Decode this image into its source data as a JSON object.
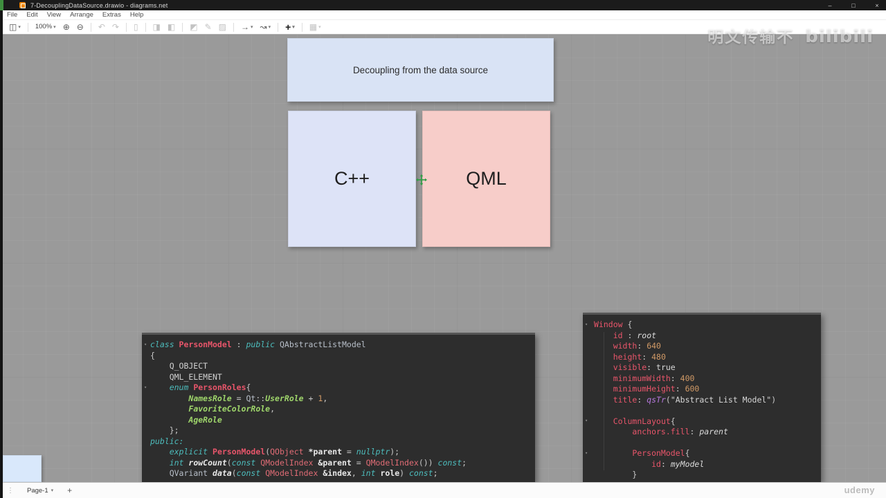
{
  "window": {
    "title": "7-DecouplingDataSource.drawio - diagrams.net",
    "minimize": "–",
    "maximize": "□",
    "close": "×"
  },
  "menu": {
    "items": [
      "File",
      "Edit",
      "View",
      "Arrange",
      "Extras",
      "Help"
    ]
  },
  "toolbar": {
    "view_glyph": "◫",
    "caret": "▾",
    "zoom_level": "100%",
    "zoom_in": "⊕",
    "zoom_out": "⊖",
    "undo": "↶",
    "redo": "↷",
    "delete": "▯",
    "to_front": "◨",
    "to_back": "◧",
    "fill_color": "◩",
    "line_color": "✎",
    "shadow": "▨",
    "connection": "→",
    "waypoints": "↝",
    "insert": "+",
    "table": "▦"
  },
  "diagram": {
    "title_box_label": "Decoupling from the data source",
    "cpp_label": "C++",
    "qml_label": "QML"
  },
  "colors": {
    "title_box_fill": "#d9e3f5",
    "cpp_box_fill": "#dde3f7",
    "qml_box_fill": "#f7cdc9",
    "code_background": "#2d2d2d",
    "canvas_background": "#9a9a9a"
  },
  "code_cpp": {
    "lines": [
      [
        [
          "kw",
          "class "
        ],
        [
          "cls",
          "PersonModel"
        ],
        [
          "pln",
          " : "
        ],
        [
          "kw",
          "public "
        ],
        [
          "gry",
          "QAbstractListModel"
        ]
      ],
      [
        [
          "pln",
          "{"
        ]
      ],
      [
        [
          "mac",
          "    Q_OBJECT"
        ]
      ],
      [
        [
          "mac",
          "    QML_ELEMENT"
        ]
      ],
      [
        [
          "pln",
          "    "
        ],
        [
          "kw",
          "enum "
        ],
        [
          "cls",
          "PersonRoles"
        ],
        [
          "pln",
          "{"
        ]
      ],
      [
        [
          "pln",
          "        "
        ],
        [
          "enm",
          "NamesRole"
        ],
        [
          "pln",
          " = "
        ],
        [
          "gry",
          "Qt"
        ],
        [
          "pln",
          "::"
        ],
        [
          "enm",
          "UserRole"
        ],
        [
          "pln",
          " + "
        ],
        [
          "num",
          "1"
        ],
        [
          "pln",
          ","
        ]
      ],
      [
        [
          "pln",
          "        "
        ],
        [
          "enm",
          "FavoriteColorRole"
        ],
        [
          "pln",
          ","
        ]
      ],
      [
        [
          "pln",
          "        "
        ],
        [
          "enm",
          "AgeRole"
        ]
      ],
      [
        [
          "pln",
          "    };"
        ]
      ],
      [
        [
          "kw",
          "public:"
        ]
      ],
      [
        [
          "pln",
          "    "
        ],
        [
          "kw",
          "explicit "
        ],
        [
          "cls",
          "PersonModel"
        ],
        [
          "pln",
          "("
        ],
        [
          "typ",
          "QObject"
        ],
        [
          "pln",
          " "
        ],
        [
          "var",
          "*parent"
        ],
        [
          "pln",
          " = "
        ],
        [
          "kw",
          "nullptr"
        ],
        [
          "pln",
          ");"
        ]
      ],
      [
        [
          "pln",
          "    "
        ],
        [
          "kw",
          "int "
        ],
        [
          "fn",
          "rowCount"
        ],
        [
          "pln",
          "("
        ],
        [
          "kw",
          "const "
        ],
        [
          "typ",
          "QModelIndex"
        ],
        [
          "pln",
          " "
        ],
        [
          "var",
          "&parent"
        ],
        [
          "pln",
          " = "
        ],
        [
          "typ",
          "QModelIndex"
        ],
        [
          "pln",
          "()) "
        ],
        [
          "kw",
          "const"
        ],
        [
          "pln",
          ";"
        ]
      ],
      [
        [
          "pln",
          "    "
        ],
        [
          "gry",
          "QVariant "
        ],
        [
          "fn",
          "data"
        ],
        [
          "pln",
          "("
        ],
        [
          "kw",
          "const "
        ],
        [
          "typ",
          "QModelIndex"
        ],
        [
          "pln",
          " "
        ],
        [
          "var",
          "&index"
        ],
        [
          "pln",
          ", "
        ],
        [
          "kw",
          "int "
        ],
        [
          "var",
          "role"
        ],
        [
          "pln",
          ") "
        ],
        [
          "kw",
          "const"
        ],
        [
          "pln",
          ";"
        ]
      ]
    ]
  },
  "code_qml": {
    "lines": [
      [
        [
          "typq",
          "Window "
        ],
        [
          "pln",
          "{"
        ]
      ],
      [
        [
          "pln",
          "    "
        ],
        [
          "prop",
          "id"
        ],
        [
          "pln",
          " : "
        ],
        [
          "itl",
          "root"
        ]
      ],
      [
        [
          "pln",
          "    "
        ],
        [
          "prop",
          "width"
        ],
        [
          "pln",
          ": "
        ],
        [
          "num",
          "640"
        ]
      ],
      [
        [
          "pln",
          "    "
        ],
        [
          "prop",
          "height"
        ],
        [
          "pln",
          ": "
        ],
        [
          "num",
          "480"
        ]
      ],
      [
        [
          "pln",
          "    "
        ],
        [
          "prop",
          "visible"
        ],
        [
          "pln",
          ": "
        ],
        [
          "bool",
          "true"
        ]
      ],
      [
        [
          "pln",
          "    "
        ],
        [
          "prop",
          "minimumWidth"
        ],
        [
          "pln",
          ": "
        ],
        [
          "num",
          "400"
        ]
      ],
      [
        [
          "pln",
          "    "
        ],
        [
          "prop",
          "minimumHeight"
        ],
        [
          "pln",
          ": "
        ],
        [
          "num",
          "600"
        ]
      ],
      [
        [
          "pln",
          "    "
        ],
        [
          "prop",
          "title"
        ],
        [
          "pln",
          ": "
        ],
        [
          "fnp",
          "qsTr"
        ],
        [
          "pln",
          "("
        ],
        [
          "str",
          "\"Abstract List Model\""
        ],
        [
          "pln",
          ")"
        ]
      ],
      [],
      [
        [
          "pln",
          "    "
        ],
        [
          "typq",
          "ColumnLayout"
        ],
        [
          "pln",
          "{"
        ]
      ],
      [
        [
          "pln",
          "        "
        ],
        [
          "prop",
          "anchors.fill"
        ],
        [
          "pln",
          ": "
        ],
        [
          "itl",
          "parent"
        ]
      ],
      [],
      [
        [
          "pln",
          "        "
        ],
        [
          "typq",
          "PersonModel"
        ],
        [
          "pln",
          "{"
        ]
      ],
      [
        [
          "pln",
          "            "
        ],
        [
          "prop",
          "id"
        ],
        [
          "pln",
          ": "
        ],
        [
          "itl",
          "myModel"
        ]
      ],
      [
        [
          "pln",
          "        }"
        ]
      ]
    ]
  },
  "watermarks": {
    "uploader": "明文传输不",
    "logo": "bilibili",
    "course_platform": "udemy"
  },
  "footer": {
    "handle": "⋮",
    "page_tab": "Page-1",
    "caret": "▾",
    "add_page": "+"
  }
}
